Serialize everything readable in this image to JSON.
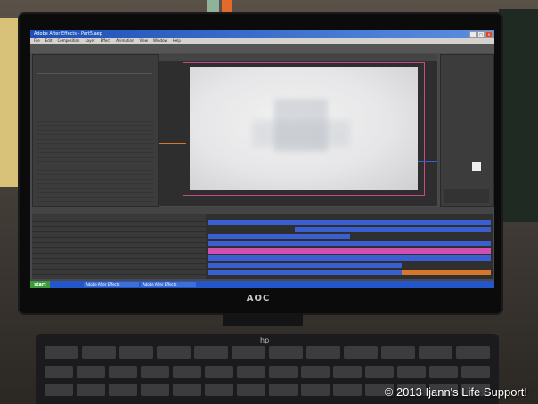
{
  "photo": {
    "monitor_brand": "AOC",
    "keyboard_brand": "hp",
    "watermark": "© 2013 Ijann's Life Support!"
  },
  "app": {
    "window_title": "Adobe After Effects - Part5.aep",
    "menu": [
      "File",
      "Edit",
      "Composition",
      "Layer",
      "Effect",
      "Animation",
      "View",
      "Window",
      "Help"
    ],
    "window_buttons": [
      "_",
      "□",
      "×"
    ]
  },
  "taskbar": {
    "start_label": "start",
    "items": [
      "Adobe After Effects",
      "Adobe After Effects"
    ]
  },
  "colors": {
    "timeline_blue": "#3a5fd0",
    "timeline_magenta": "#d14fb3",
    "timeline_orange": "#d7772b",
    "comp_border": "#c44a8a",
    "taskbar": "#2356c9"
  }
}
